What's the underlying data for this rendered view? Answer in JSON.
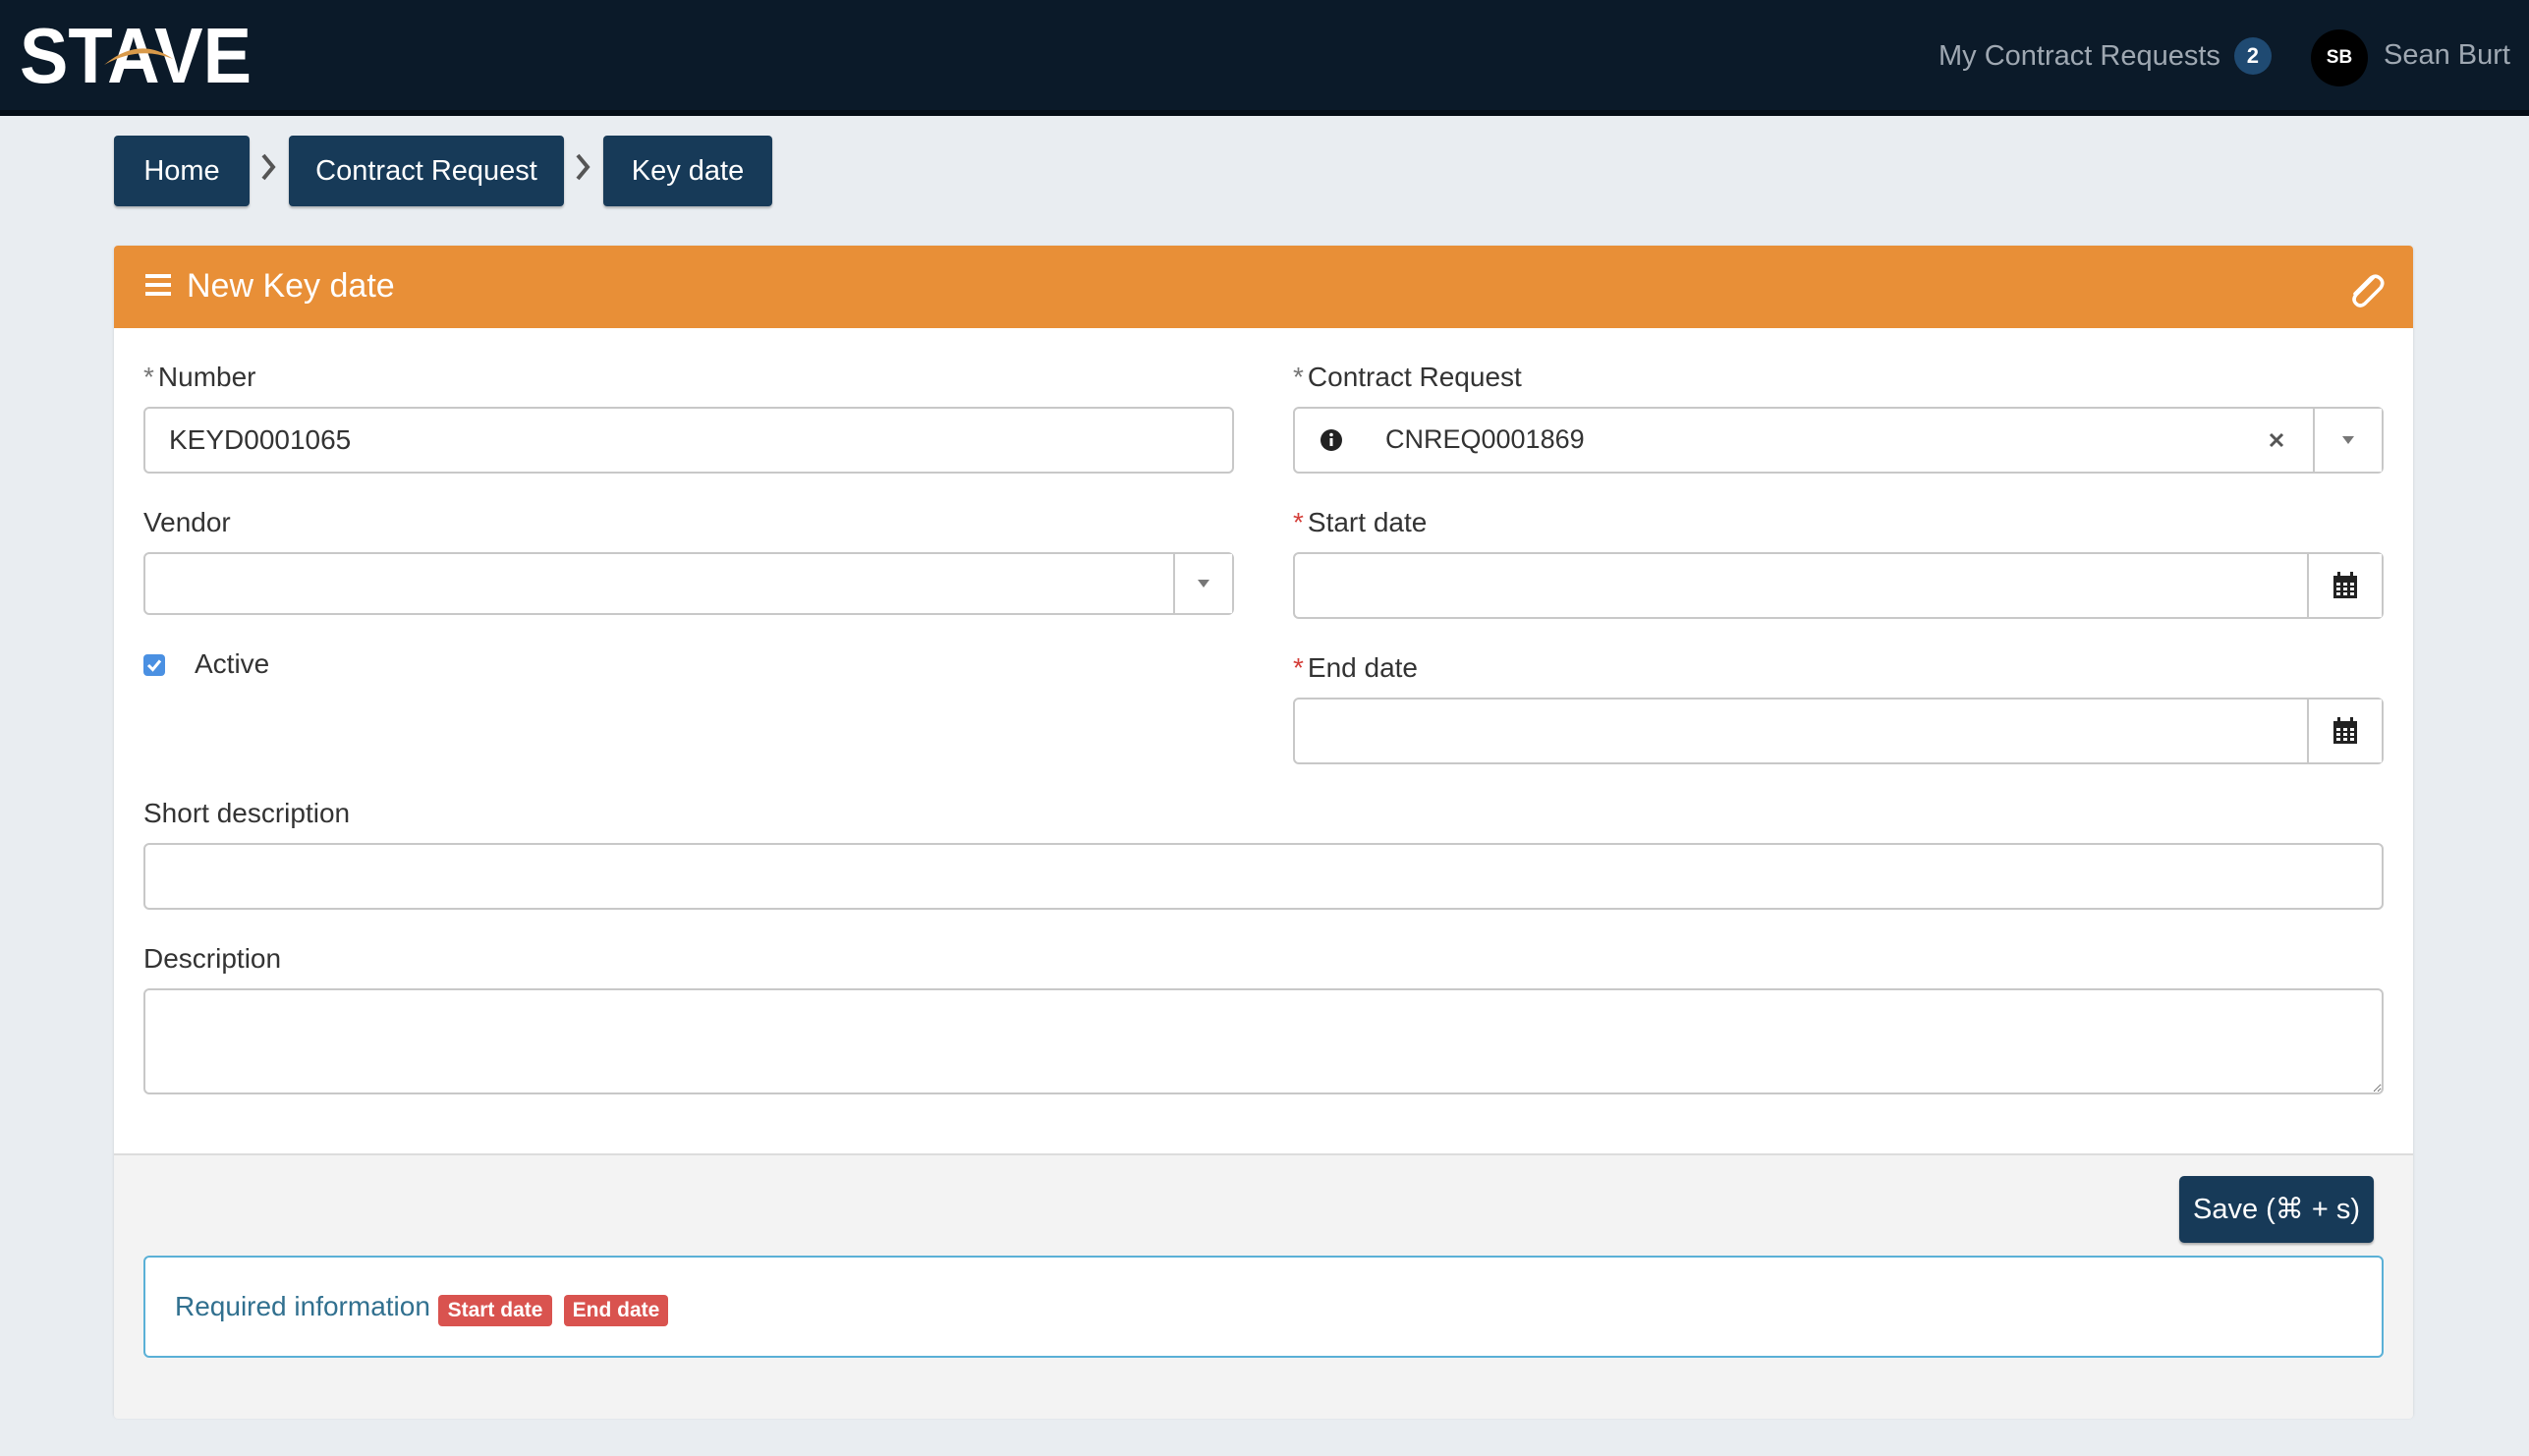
{
  "app": {
    "logo_text": "STAVE",
    "brand_colors": {
      "navbar": "#0b1a29",
      "primary": "#173a58",
      "header": "#e88f37",
      "accent": "#d99a4a"
    }
  },
  "navbar": {
    "my_requests_label": "My Contract Requests",
    "my_requests_count": "2",
    "user_initials": "SB",
    "user_name": "Sean Burt"
  },
  "breadcrumb": {
    "home": "Home",
    "contract_request": "Contract Request",
    "key_date": "Key date"
  },
  "form": {
    "title": "New Key date",
    "number": {
      "label": "Number",
      "value": "KEYD0001065",
      "required": true
    },
    "contract_request": {
      "label": "Contract Request",
      "value": "CNREQ0001869",
      "required": true
    },
    "vendor": {
      "label": "Vendor",
      "value": ""
    },
    "start_date": {
      "label": "Start date",
      "value": "",
      "required": true
    },
    "end_date": {
      "label": "End date",
      "value": "",
      "required": true
    },
    "active": {
      "label": "Active",
      "checked": true
    },
    "short_description": {
      "label": "Short description",
      "value": ""
    },
    "description": {
      "label": "Description",
      "value": ""
    },
    "required_marker": "*"
  },
  "footer": {
    "save_label": "Save (⌘ + s)",
    "required_info_label": "Required information",
    "missing_fields": [
      "Start date",
      "End date"
    ]
  },
  "icons": {
    "menu": "hamburger-icon",
    "attachment": "paperclip-icon",
    "info": "info-circle-icon",
    "clear": "close-icon",
    "dropdown": "caret-down-icon",
    "calendar": "calendar-icon",
    "separator": "chevron-right-icon",
    "checkbox": "checkmark-icon"
  }
}
